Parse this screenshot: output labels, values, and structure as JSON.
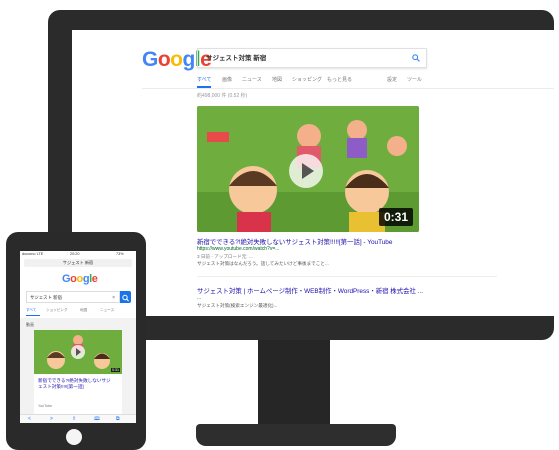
{
  "desktop": {
    "logo": [
      "G",
      "o",
      "o",
      "g",
      "l",
      "e"
    ],
    "logo_colors": [
      "#4285f4",
      "#ea4335",
      "#fbbc05",
      "#4285f4",
      "#34a853",
      "#ea4335"
    ],
    "search_query": "サジェスト対策 新宿",
    "tabs": [
      "すべて",
      "画像",
      "ニュース",
      "地図",
      "ショッピング",
      "もっと見る",
      "設定",
      "ツール"
    ],
    "result_stats": "約498,000 件 (0.52 秒)",
    "video_duration": "0:31",
    "result1": {
      "title": "新宿でできる?!絶対失敗しないサジェスト対策!!!!![第一話] - YouTube",
      "url": "https://www.youtube.com/watch?v=...",
      "meta": "3 日前 - アップロード元: ...",
      "desc": "サジェスト対策はなんだろう。話してみたいけど事後までこと..."
    },
    "result2": {
      "title": "サジェスト対策 | ホームページ制作・WEB制作・WordPress・新宿 株式会社 ...",
      "url": "...",
      "desc": "サジェスト対策(検索エンジン最適化)..."
    }
  },
  "phone": {
    "status": {
      "carrier": "docomo LTE",
      "time": "20:20",
      "battery": "73%"
    },
    "url": "サジェスト 新宿",
    "logo": [
      "G",
      "o",
      "o",
      "g",
      "l",
      "e"
    ],
    "search_query": "サジェスト 新宿",
    "clear_symbol": "×",
    "tabs": [
      "すべて",
      "ショッピング",
      "地図",
      "ニュース"
    ],
    "section_label": "動画",
    "video_duration": "0:31",
    "video_title": "新宿でできる?!絶対失敗しないサジェスト対策!!!!![第一話]",
    "video_source": "YouTube",
    "bottom_icons": [
      "<",
      ">",
      "share",
      "book",
      "tabs"
    ]
  }
}
